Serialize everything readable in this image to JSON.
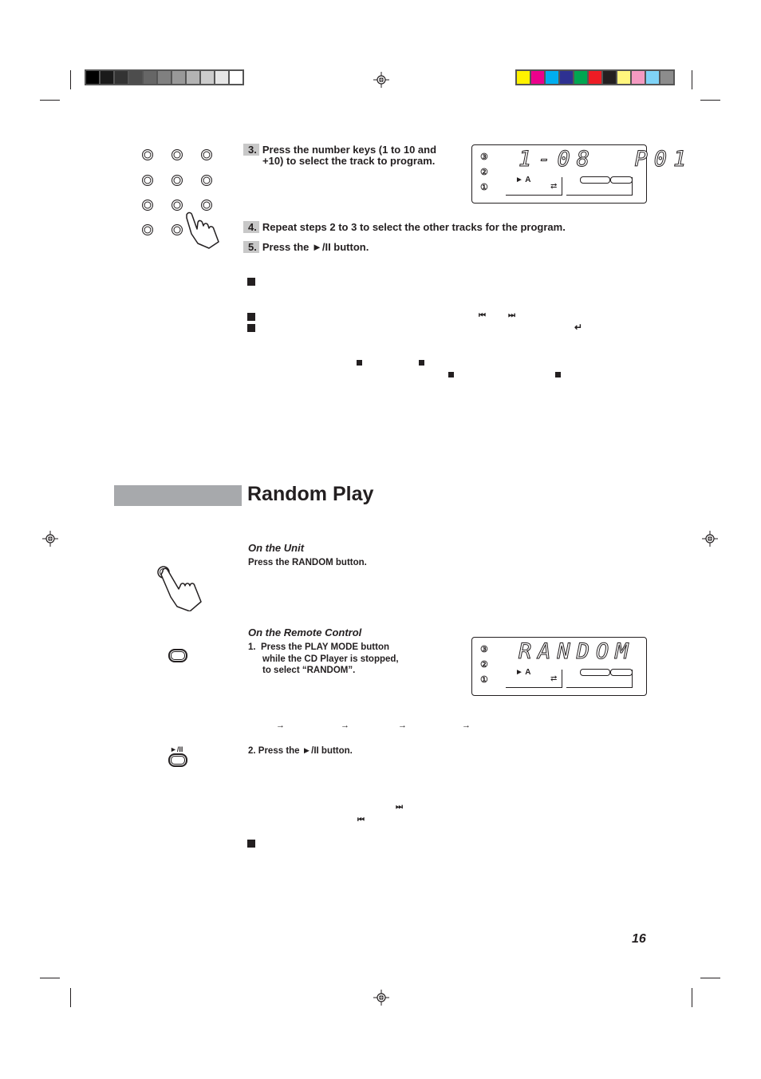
{
  "print_marks": {
    "grayscale_bar": [
      "#000000",
      "#1a1a1a",
      "#333333",
      "#4d4d4d",
      "#666666",
      "#808080",
      "#999999",
      "#b3b3b3",
      "#cccccc",
      "#e6e6e6",
      "#ffffff"
    ],
    "color_bar": [
      "#fff200",
      "#ec008c",
      "#00aeef",
      "#2e3192",
      "#00a651",
      "#ed1c24",
      "#231f20",
      "#fff57d",
      "#f49ac1",
      "#7fd3f7",
      "#8c8c8c"
    ]
  },
  "program_section": {
    "steps": [
      {
        "num": "3.",
        "text_line1": "Press the number keys (1 to 10 and",
        "text_line2": "+10) to select the track to program."
      },
      {
        "num": "4.",
        "text": "Repeat steps 2 to 3 to select the other tracks for the program."
      },
      {
        "num": "5.",
        "text": "Press the ►/II button."
      }
    ],
    "display_1": {
      "text": "1-08  P01",
      "indicator": "► A"
    },
    "inline_icons": {
      "prev": "⏮",
      "next": "⏭",
      "repeat": "↵"
    }
  },
  "random_section": {
    "title": "Random Play",
    "on_unit": {
      "heading": "On the Unit",
      "instruction": "Press the RANDOM button."
    },
    "on_remote": {
      "heading": "On the Remote Control",
      "step1_num": "1.",
      "step1_line1": "Press the PLAY MODE button",
      "step1_line2": "while the CD Player is stopped,",
      "step1_line3": "to select “RANDOM”.",
      "step2": "2.  Press the ►/II button.",
      "play_button_label": "►/II"
    },
    "display_2": {
      "text": "RANDOM",
      "indicator": "► A"
    },
    "arrows": [
      "→",
      "→",
      "→",
      "→"
    ],
    "inline_icons": {
      "next": "⏭",
      "prev": "⏮"
    }
  },
  "page_number": "16"
}
